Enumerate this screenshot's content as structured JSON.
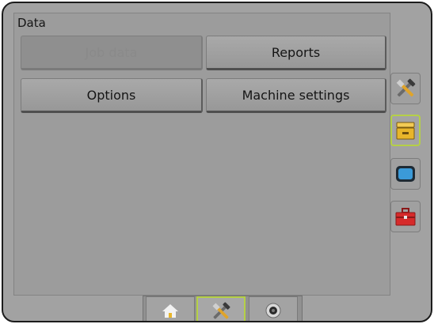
{
  "panel": {
    "title": "Data"
  },
  "buttons": {
    "job_data": "Job data",
    "reports": "Reports",
    "options": "Options",
    "machine_settings": "Machine settings"
  },
  "side_tabs": [
    {
      "icon": "tools-icon",
      "active": false
    },
    {
      "icon": "data-drawer-icon",
      "active": true
    },
    {
      "icon": "console-screen-icon",
      "active": false
    },
    {
      "icon": "toolbox-icon",
      "active": false
    }
  ],
  "bottom_tabs": [
    {
      "icon": "home-icon",
      "active": false
    },
    {
      "icon": "tools-icon",
      "active": true
    },
    {
      "icon": "camera-icon",
      "active": false
    }
  ],
  "colors": {
    "active_outline": "#b5d046",
    "drawer_yellow": "#e8b52a",
    "screen_blue": "#3b9ad8",
    "toolbox_red": "#d62a2a"
  }
}
